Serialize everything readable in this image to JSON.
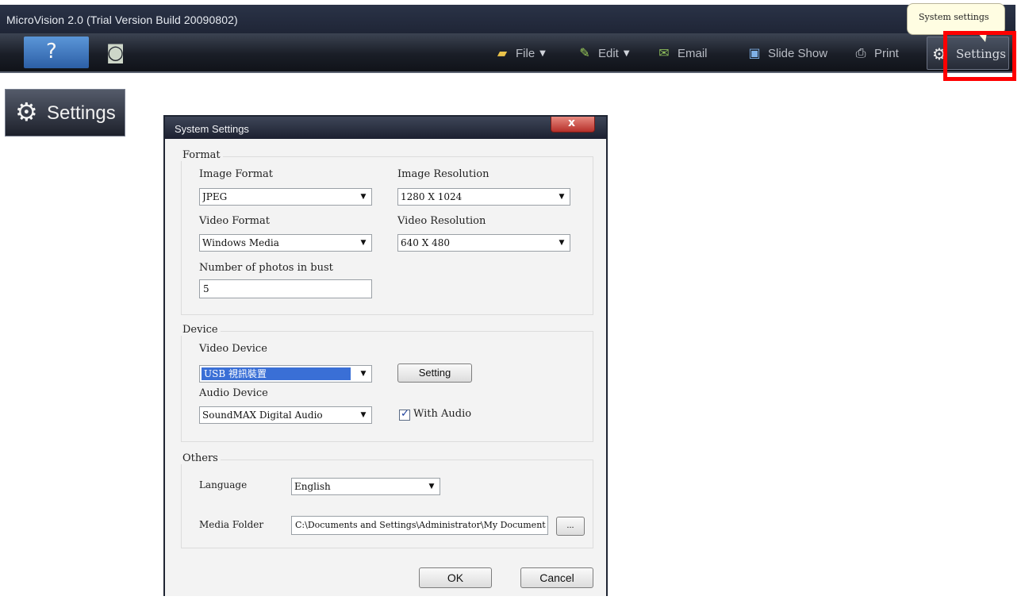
{
  "app": {
    "title": "MicroVision 2.0 (Trial Version Build 20090802)"
  },
  "toolbar": {
    "help_icon": "help-icon",
    "camera_icon": "camera-icon",
    "items": [
      {
        "label": "File",
        "icon": "folder-icon",
        "dropdown": true
      },
      {
        "label": "Edit",
        "icon": "edit-icon",
        "dropdown": true
      },
      {
        "label": "Email",
        "icon": "email-icon",
        "dropdown": false
      },
      {
        "label": "Slide Show",
        "icon": "slideshow-icon",
        "dropdown": false
      },
      {
        "label": "Print",
        "icon": "printer-icon",
        "dropdown": false
      }
    ],
    "settings_label": "Settings",
    "tooltip": "System settings"
  },
  "callout": {
    "settings_label": "Settings"
  },
  "dialog": {
    "title": "System Settings",
    "close_label": "x",
    "format": {
      "group_label": "Format",
      "image_format_label": "Image Format",
      "image_format_value": "JPEG",
      "image_resolution_label": "Image Resolution",
      "image_resolution_value": "1280 X 1024",
      "video_format_label": "Video Format",
      "video_format_value": "Windows Media",
      "video_resolution_label": "Video Resolution",
      "video_resolution_value": "640 X 480",
      "burst_label": "Number of photos in bust",
      "burst_value": "5"
    },
    "device": {
      "group_label": "Device",
      "video_device_label": "Video Device",
      "video_device_value": "USB 視訊裝置",
      "setting_button": "Setting",
      "audio_device_label": "Audio Device",
      "audio_device_value": "SoundMAX Digital Audio",
      "with_audio_label": "With Audio",
      "with_audio_checked": true
    },
    "others": {
      "group_label": "Others",
      "language_label": "Language",
      "language_value": "English",
      "media_folder_label": "Media Folder",
      "media_folder_value": "C:\\Documents and Settings\\Administrator\\My Documents",
      "browse_label": "..."
    },
    "ok_label": "OK",
    "cancel_label": "Cancel"
  },
  "colors": {
    "highlight": "#ff0000",
    "selection": "#3a6fd6"
  }
}
